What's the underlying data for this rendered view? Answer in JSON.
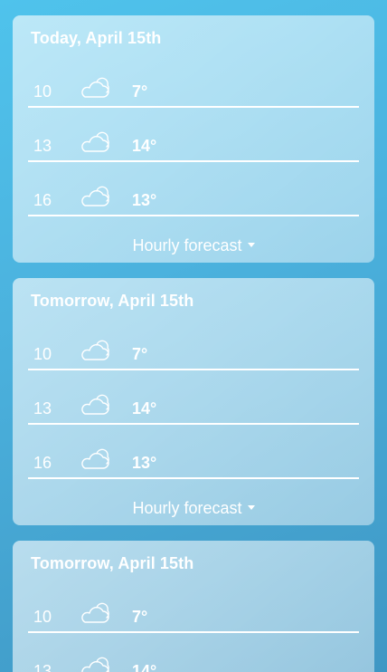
{
  "days": [
    {
      "title": "Today, April 15th",
      "hours": [
        {
          "time": "10",
          "icon": "cloud-sun-icon",
          "temp": "7°"
        },
        {
          "time": "13",
          "icon": "cloud-sun-icon",
          "temp": "14°"
        },
        {
          "time": "16",
          "icon": "cloud-sun-icon",
          "temp": "13°"
        }
      ],
      "toggle_label": "Hourly forecast"
    },
    {
      "title": "Tomorrow, April 15th",
      "hours": [
        {
          "time": "10",
          "icon": "cloud-sun-icon",
          "temp": "7°"
        },
        {
          "time": "13",
          "icon": "cloud-sun-icon",
          "temp": "14°"
        },
        {
          "time": "16",
          "icon": "cloud-sun-icon",
          "temp": "13°"
        }
      ],
      "toggle_label": "Hourly forecast"
    },
    {
      "title": "Tomorrow, April 15th",
      "hours": [
        {
          "time": "10",
          "icon": "cloud-sun-icon",
          "temp": "7°"
        },
        {
          "time": "13",
          "icon": "cloud-sun-icon",
          "temp": "14°"
        }
      ]
    }
  ],
  "colors": {
    "background_top": "#4fc3ec",
    "background_bottom": "#3f97c4",
    "text": "#ffffff"
  }
}
